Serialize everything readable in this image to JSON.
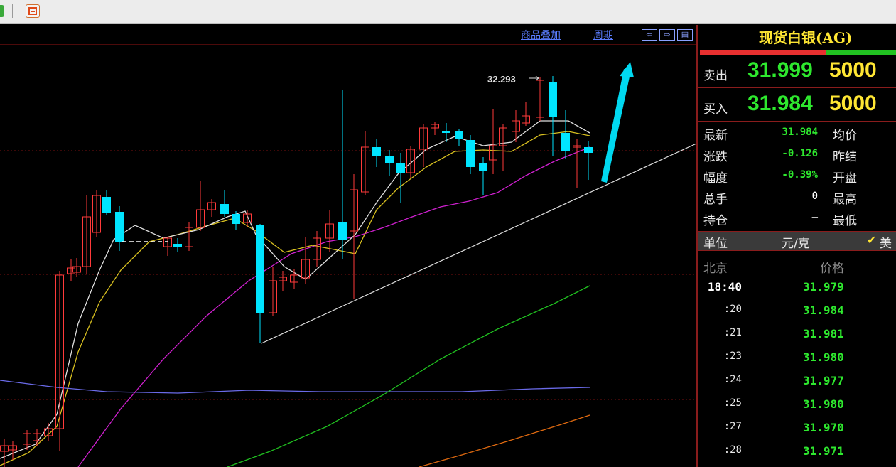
{
  "toolbar": {
    "icons": [
      "green-app-icon",
      "grid-window-icon"
    ]
  },
  "chart": {
    "links": {
      "overlay": "商品叠加",
      "period": "周期"
    },
    "nav_icons": [
      "arrow-left-box-icon",
      "arrow-right-box-icon",
      "split-view-icon"
    ],
    "high_label": "32.293",
    "colors": {
      "up": "#ff3a3a",
      "down": "#00e5ff",
      "ma5": "#e0e0e0",
      "ma10": "#d8c020",
      "ma20": "#d020d0",
      "ma60": "#6a6ae8",
      "ma_green": "#20c020",
      "ma_orange": "#e06a10",
      "trend": "#dddddd",
      "arrow": "#00d8f0",
      "grid": "#7a1010"
    }
  },
  "panel": {
    "title": "现货白银(AG)",
    "sell": {
      "label": "卖出",
      "price": "31.999",
      "volume": "5000"
    },
    "buy": {
      "label": "买入",
      "price": "31.984",
      "volume": "5000"
    },
    "stats": [
      {
        "label": "最新",
        "value": "31.984",
        "right": "均价"
      },
      {
        "label": "涨跌",
        "value": "-0.126",
        "right": "昨结"
      },
      {
        "label": "幅度",
        "value": "-0.39%",
        "right": "开盘"
      },
      {
        "label": "总手",
        "value": "0",
        "right": "最高",
        "white": true
      },
      {
        "label": "持仓",
        "value": "—",
        "right": "最低",
        "white": true
      }
    ],
    "unit": {
      "label": "单位",
      "value": "元/克",
      "check": "✔",
      "check_label": "美"
    },
    "ticks_header": {
      "city": "北京",
      "price": "价格"
    },
    "ticks": [
      {
        "time": "18:40",
        "price": "31.979"
      },
      {
        "time": ":20",
        "price": "31.984"
      },
      {
        "time": ":21",
        "price": "31.981"
      },
      {
        "time": ":23",
        "price": "31.980"
      },
      {
        "time": ":24",
        "price": "31.977"
      },
      {
        "time": ":25",
        "price": "31.980"
      },
      {
        "time": ":27",
        "price": "31.970"
      },
      {
        "time": ":28",
        "price": "31.971"
      }
    ]
  }
}
